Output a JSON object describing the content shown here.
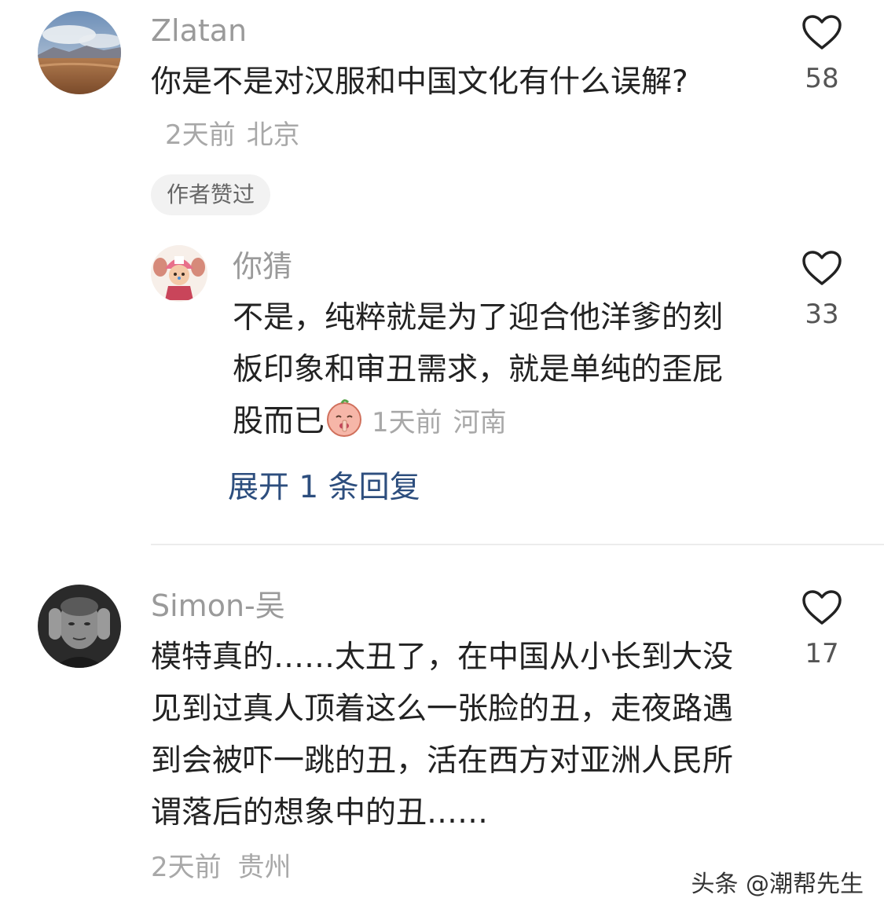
{
  "comments": [
    {
      "user": "Zlatan",
      "text": "你是不是对汉服和中国文化有什么误解?",
      "time": "2天前",
      "location": "北京",
      "likes": "58",
      "tag": "作者赞过"
    },
    {
      "user": "你猜",
      "text": "不是，纯粹就是为了迎合他洋爹的刻板印象和审丑需求，就是单纯的歪屁股而已",
      "emoji": "shush-face-emoji",
      "time": "1天前",
      "location": "河南",
      "likes": "33",
      "expand": "展开 1 条回复"
    },
    {
      "user": "Simon-吴",
      "text": "模特真的……太丑了，在中国从小长到大没见到过真人顶着这么一张脸的丑，走夜路遇到会被吓一跳的丑，活在西方对亚洲人民所谓落后的想象中的丑……",
      "time": "2天前",
      "location": "贵州",
      "likes": "17"
    }
  ],
  "watermark": "头条 @潮帮先生",
  "icons": {
    "like": "heart-outline-icon"
  },
  "colors": {
    "username": "#9a9a9a",
    "meta": "#a8a8a8",
    "link": "#2d4e7e",
    "heart": "#222222"
  }
}
